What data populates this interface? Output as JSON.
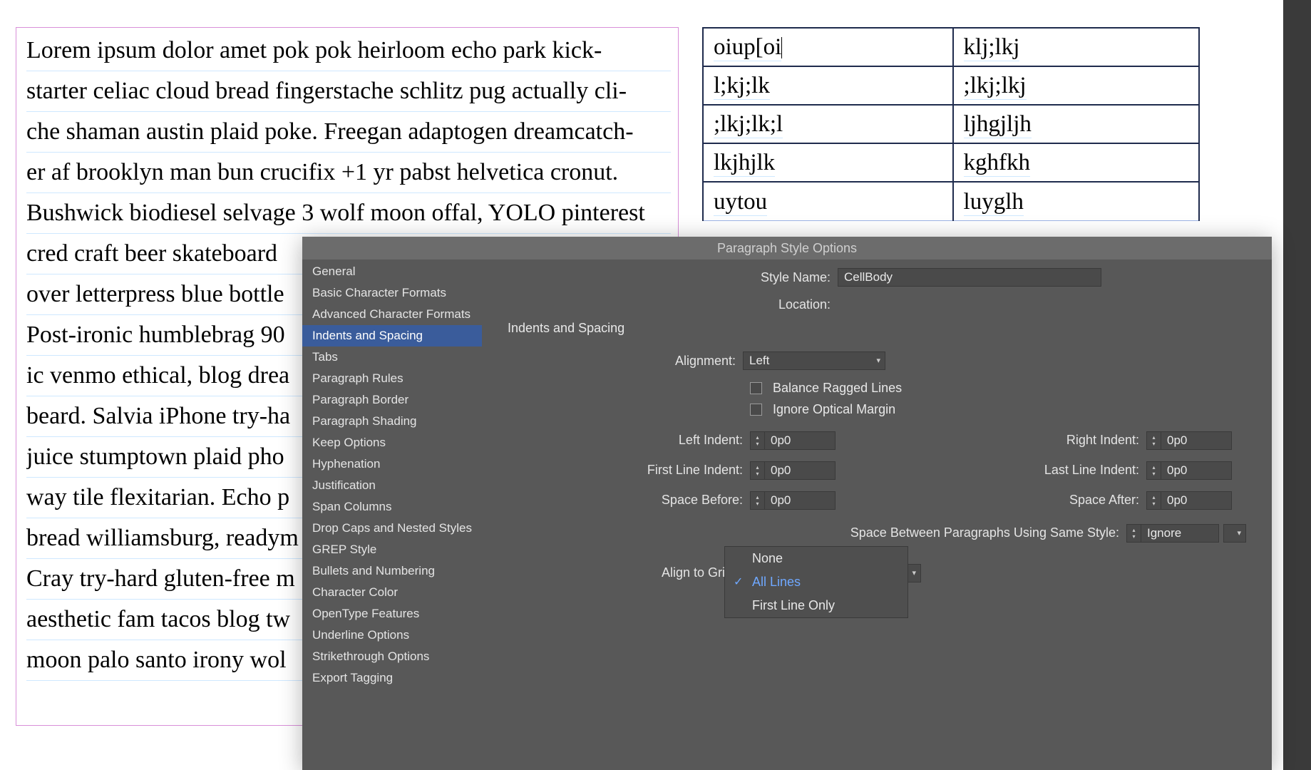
{
  "textframe": {
    "lines": [
      "Lorem ipsum dolor amet pok pok heirloom echo park kick-",
      "starter celiac cloud bread fingerstache schlitz pug actually cli-",
      "che shaman austin plaid poke. Freegan adaptogen dreamcatch-",
      "er af brooklyn man bun crucifix +1 yr pabst helvetica cronut.",
      "Bushwick biodiesel selvage 3 wolf moon offal, YOLO pinterest",
      "cred craft beer skateboard ",
      "over letterpress blue bottle ",
      "Post-ironic humblebrag 90",
      "ic venmo ethical, blog drea",
      "beard. Salvia iPhone try-ha",
      "juice stumptown plaid pho",
      "way tile flexitarian. Echo p",
      "bread williamsburg, readym",
      "Cray try-hard gluten-free m",
      "aesthetic fam tacos blog tw",
      "moon palo santo irony wol"
    ]
  },
  "table": {
    "rows": [
      [
        "oiup[oi",
        "klj;lkj"
      ],
      [
        "l;kj;lk",
        ";lkj;lkj"
      ],
      [
        ";lkj;lk;l",
        "ljhgjljh"
      ],
      [
        "lkjhjlk",
        "kghfkh"
      ],
      [
        "uytou",
        "luyglh"
      ]
    ]
  },
  "dialog": {
    "title": "Paragraph Style Options",
    "style_name_label": "Style Name:",
    "style_name_value": "CellBody",
    "location_label": "Location:",
    "section_header": "Indents and Spacing",
    "sidebar": [
      "General",
      "Basic Character Formats",
      "Advanced Character Formats",
      "Indents and Spacing",
      "Tabs",
      "Paragraph Rules",
      "Paragraph Border",
      "Paragraph Shading",
      "Keep Options",
      "Hyphenation",
      "Justification",
      "Span Columns",
      "Drop Caps and Nested Styles",
      "GREP Style",
      "Bullets and Numbering",
      "Character Color",
      "OpenType Features",
      "Underline Options",
      "Strikethrough Options",
      "Export Tagging"
    ],
    "selected_sidebar_index": 3,
    "alignment_label": "Alignment:",
    "alignment_value": "Left",
    "balance_label": "Balance Ragged Lines",
    "ignore_optical_label": "Ignore Optical Margin",
    "left_indent_label": "Left Indent:",
    "left_indent_value": "0p0",
    "right_indent_label": "Right Indent:",
    "right_indent_value": "0p0",
    "first_line_label": "First Line Indent:",
    "first_line_value": "0p0",
    "last_line_label": "Last Line Indent:",
    "last_line_value": "0p0",
    "space_before_label": "Space Before:",
    "space_before_value": "0p0",
    "space_after_label": "Space After:",
    "space_after_value": "0p0",
    "space_between_label": "Space Between Paragraphs Using Same Style:",
    "space_between_value": "Ignore",
    "align_grid_label": "Align to Grid:",
    "align_grid_value": "All Lines",
    "align_grid_options": [
      "None",
      "All Lines",
      "First Line Only"
    ],
    "align_grid_selected_index": 1
  }
}
